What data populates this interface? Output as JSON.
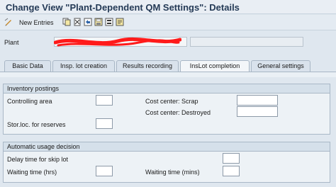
{
  "window": {
    "title": "Change View \"Plant-Dependent QM Settings\": Details"
  },
  "toolbar": {
    "new_entries_label": "New Entries",
    "icons": [
      "change-display-icon",
      "copy-icon",
      "delete-icon",
      "undo-icon",
      "save-icon",
      "select-all-icon"
    ]
  },
  "plant": {
    "label": "Plant",
    "value": "",
    "description": ""
  },
  "tabs": [
    {
      "label": "Basic Data",
      "active": false
    },
    {
      "label": "Insp. lot creation",
      "active": false
    },
    {
      "label": "Results recording",
      "active": false
    },
    {
      "label": "InsLot completion",
      "active": true
    },
    {
      "label": "General settings",
      "active": false
    }
  ],
  "inventory_postings": {
    "title": "Inventory postings",
    "controlling_area": {
      "label": "Controlling area",
      "value": ""
    },
    "cost_center_scrap": {
      "label": "Cost center: Scrap",
      "value": ""
    },
    "cost_center_destroyed": {
      "label": "Cost center: Destroyed",
      "value": ""
    },
    "stor_loc_reserves": {
      "label": "Stor.loc. for reserves",
      "value": ""
    }
  },
  "automatic_usage_decision": {
    "title": "Automatic usage decision",
    "delay_time_skip_lot": {
      "label": "Delay time for skip lot",
      "value": ""
    },
    "waiting_time_hrs": {
      "label": "Waiting time (hrs)",
      "value": ""
    },
    "waiting_time_mins": {
      "label": "Waiting time (mins)",
      "value": ""
    }
  }
}
